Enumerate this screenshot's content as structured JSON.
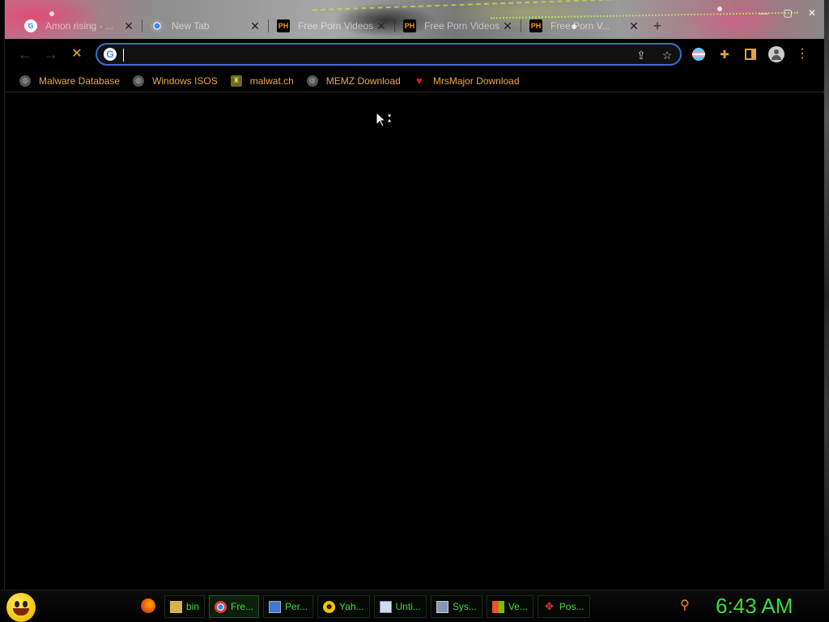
{
  "browser": {
    "tabs": [
      {
        "title": "Amon rising - ...",
        "favicon": "google-icon"
      },
      {
        "title": "New Tab",
        "favicon": "chrome-icon"
      },
      {
        "title": "Free Porn Videos",
        "favicon": "pornhub-icon"
      },
      {
        "title": "Free Porn Videos",
        "favicon": "pornhub-icon"
      },
      {
        "title": "Free Porn V...",
        "favicon": "pornhub-icon"
      }
    ],
    "new_tab_label": "+",
    "window_controls": {
      "minimize": "—",
      "maximize": "▢",
      "close": "✕"
    },
    "omnibox": {
      "value": "",
      "placeholder": ""
    },
    "bookmarks": [
      {
        "label": "Malware Database",
        "icon": "globe-icon"
      },
      {
        "label": "Windows ISOS",
        "icon": "globe-icon"
      },
      {
        "label": "malwat.ch",
        "icon": "malwatch-icon"
      },
      {
        "label": "MEMZ Download",
        "icon": "globe-icon"
      },
      {
        "label": "MrsMajor Download",
        "icon": "heart-icon"
      }
    ],
    "accent_color": "#3a6dd8",
    "bookmark_text_color": "#f0a64a"
  },
  "taskbar": {
    "tasks": [
      {
        "label": "bin",
        "icon": "folder-icon"
      },
      {
        "label": "Fre...",
        "icon": "chrome-icon",
        "active": true
      },
      {
        "label": "Per...",
        "icon": "monitor-icon"
      },
      {
        "label": "Yah...",
        "icon": "smiley-icon"
      },
      {
        "label": "Unti...",
        "icon": "notepad-icon"
      },
      {
        "label": "Sys...",
        "icon": "system-icon"
      },
      {
        "label": "Ve...",
        "icon": "windows-icon"
      },
      {
        "label": "Pos...",
        "icon": "postcard-icon"
      }
    ],
    "clock": "6:43 AM",
    "text_color": "#3ddc3d"
  }
}
